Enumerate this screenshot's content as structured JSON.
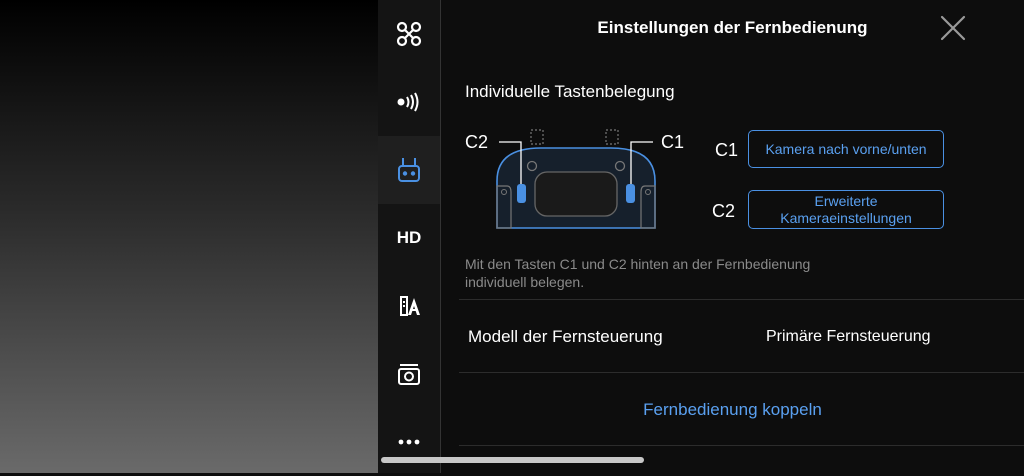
{
  "header": {
    "title": "Einstellungen der Fernbedienung"
  },
  "sidebar": {
    "items": [
      {
        "icon": "drone-icon"
      },
      {
        "icon": "signal-icon"
      },
      {
        "icon": "remote-controller-icon",
        "active": true
      },
      {
        "icon": "hd-icon",
        "label": "HD"
      },
      {
        "icon": "map-a-icon"
      },
      {
        "icon": "camera-icon"
      },
      {
        "icon": "more-icon",
        "label": "•••"
      }
    ]
  },
  "custom_buttons": {
    "title": "Individuelle Tastenbelegung",
    "illus_c2": "C2",
    "illus_c1": "C1",
    "c1_label": "C1",
    "c1_value": "Kamera nach vorne/unten",
    "c2_label": "C2",
    "c2_value_line1": "Erweiterte",
    "c2_value_line2": "Kameraeinstellungen",
    "hint_line1": "Mit den Tasten C1 und C2 hinten an der Fernbedienung",
    "hint_line2": "individuell belegen."
  },
  "model": {
    "label": "Modell der Fernsteuerung",
    "value": "Primäre Fernsteuerung"
  },
  "pair": {
    "label": "Fernbedienung koppeln"
  },
  "colors": {
    "accent": "#4a90e2",
    "background": "#0d0d0d",
    "sidebar": "#141414"
  }
}
